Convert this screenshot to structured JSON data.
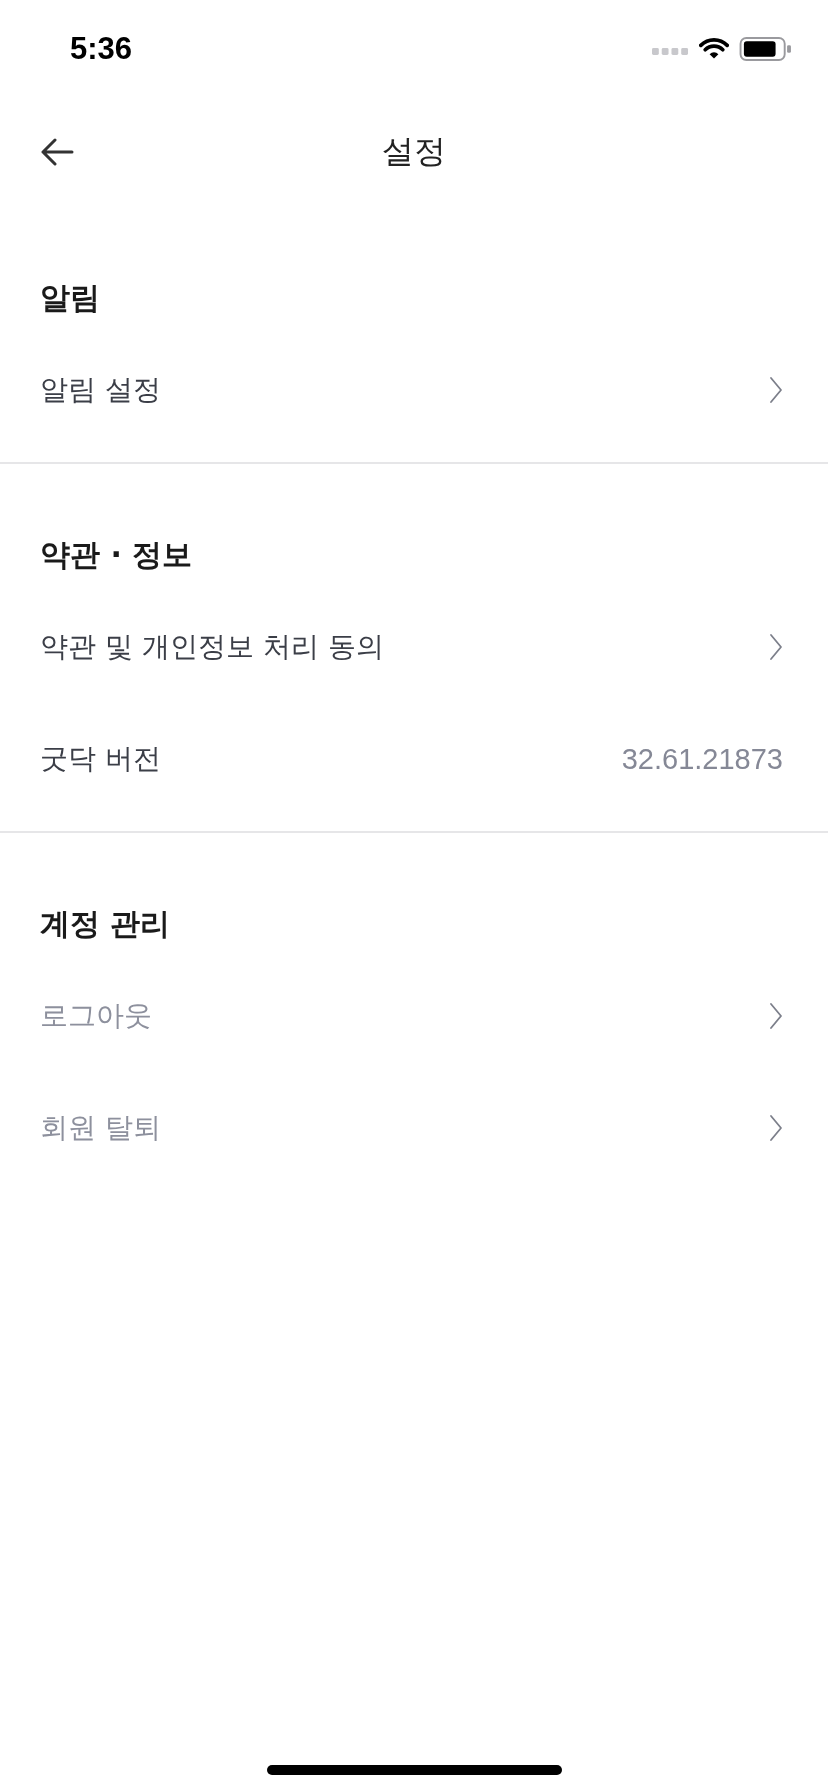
{
  "status_bar": {
    "time": "5:36"
  },
  "nav_bar": {
    "title": "설정"
  },
  "sections": [
    {
      "title": "알림",
      "items": [
        {
          "kind": "link",
          "label": "알림 설정",
          "muted": false
        }
      ]
    },
    {
      "title": "약관 · 정보",
      "items": [
        {
          "kind": "link",
          "label": "약관 및 개인정보 처리 동의",
          "muted": false
        },
        {
          "kind": "value",
          "label": "굿닥 버전",
          "value": "32.61.21873",
          "muted": false
        }
      ]
    },
    {
      "title": "계정 관리",
      "items": [
        {
          "kind": "link",
          "label": "로그아웃",
          "muted": true
        },
        {
          "kind": "link",
          "label": "회원 탈퇴",
          "muted": true
        }
      ]
    }
  ]
}
